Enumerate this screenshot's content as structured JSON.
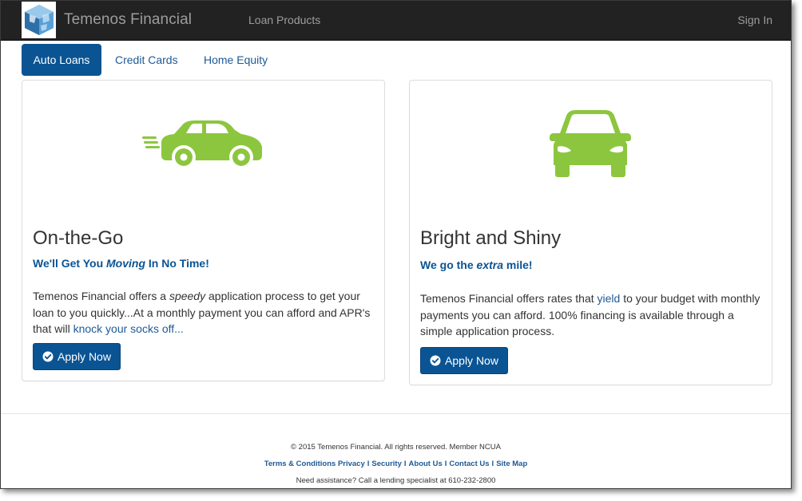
{
  "header": {
    "brand": "Temenos Financial",
    "nav_loan_products": "Loan Products",
    "sign_in": "Sign In"
  },
  "tabs": [
    {
      "label": "Auto Loans",
      "active": true
    },
    {
      "label": "Credit Cards",
      "active": false
    },
    {
      "label": "Home Equity",
      "active": false
    }
  ],
  "cards": [
    {
      "icon": "car-speed-icon",
      "title": "On-the-Go",
      "subtitle": {
        "pre": "We'll Get You ",
        "em": "Moving",
        "post": " In No Time!"
      },
      "body": {
        "t1": "Temenos Financial offers a ",
        "em": "speedy",
        "t2": " application process to get your loan to you quickly...At a monthly payment you can afford and APR's that will ",
        "link": "knock your socks off..."
      },
      "button": "Apply Now"
    },
    {
      "icon": "car-front-icon",
      "title": "Bright and Shiny",
      "subtitle": {
        "pre": "We go the ",
        "em": "extra",
        "post": " mile!"
      },
      "body": {
        "t1": "Temenos Financial offers rates that ",
        "link": "yield",
        "t2": " to your budget with monthly payments you can afford. 100% financing is available through a simple application process."
      },
      "button": "Apply Now"
    }
  ],
  "footer": {
    "copyright": "© 2015 Temenos Financial. All rights reserved.  Member NCUA",
    "links": [
      "Terms & Conditions",
      "Privacy",
      "Security",
      "About Us",
      "Contact Us",
      "Site Map"
    ],
    "separator": "I",
    "assistance": "Need assistance? Call a lending specialist at 610-232-2800"
  },
  "colors": {
    "navbar": "#222222",
    "primary": "#0a5493",
    "icon_green": "#8cc63f"
  }
}
